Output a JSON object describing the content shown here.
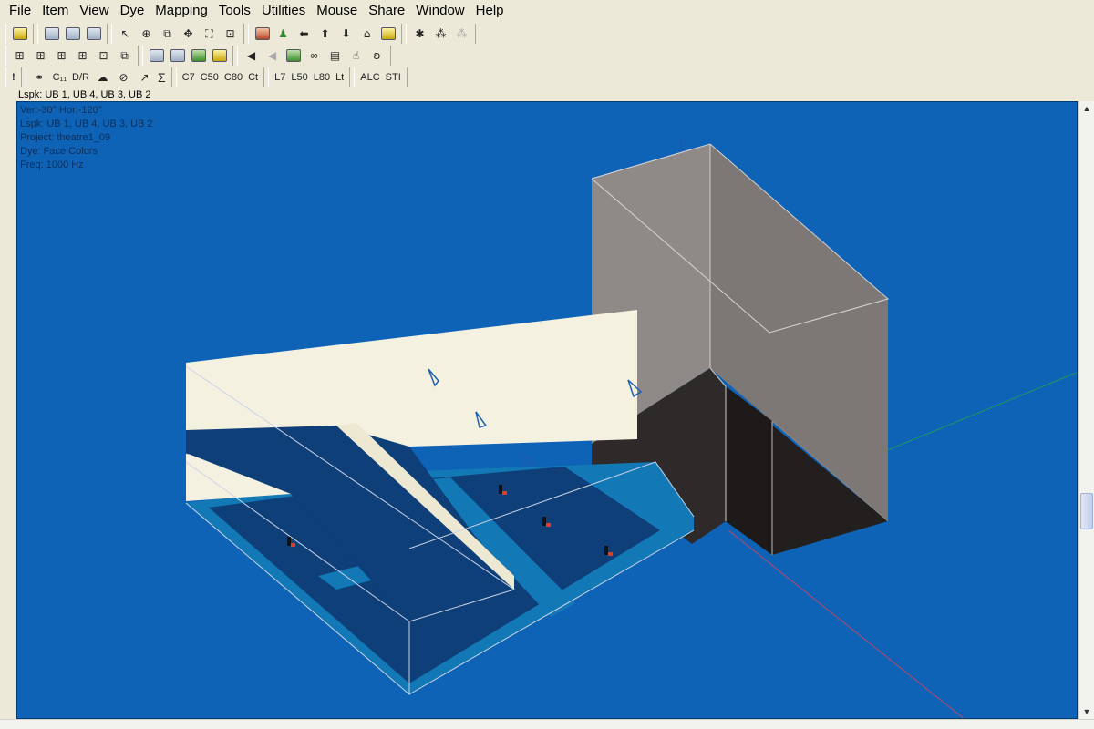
{
  "menu": [
    "File",
    "Item",
    "View",
    "Dye",
    "Mapping",
    "Tools",
    "Utilities",
    "Mouse",
    "Share",
    "Window",
    "Help"
  ],
  "toolbar3_labels": {
    "bang": "!",
    "c_cit": "C₁₁",
    "d_r": "D/R",
    "sigma": "Σ",
    "c7": "C7",
    "c50": "C50",
    "c80": "C80",
    "ct": "Ct",
    "l7": "L7",
    "l50": "L50",
    "l80": "L80",
    "lt": "Lt",
    "alc": "ALC",
    "sti": "STI"
  },
  "statusline": "Lspk: UB 1, UB 4, UB 3, UB 2",
  "overlay": {
    "view": "Ver:-30°  Hor:-120°",
    "lspk": "Lspk: UB 1, UB 4, UB 3, UB 2",
    "project": "Project: theatre1_09",
    "dye": "Dye: Face Colors",
    "freq": "Freq: 1000 Hz"
  },
  "colors": {
    "background": "#0e63b7",
    "wall_cream": "#f4f1e1",
    "tower_grey": "#8c8784",
    "tower_dark": "#2e2a29",
    "floor_dark": "#0f3f78",
    "floor_light": "#1279b6"
  }
}
